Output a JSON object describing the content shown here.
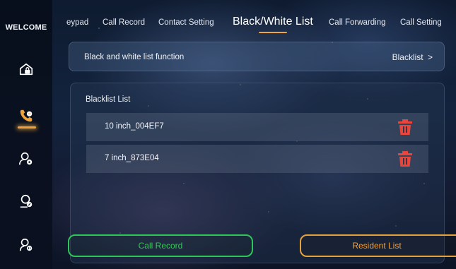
{
  "sidebar": {
    "title": "WELCOME",
    "items": [
      {
        "icon": "home-lock-icon"
      },
      {
        "icon": "phone-icon",
        "active": true
      },
      {
        "icon": "user-settings-icon"
      },
      {
        "icon": "user-edit-icon"
      },
      {
        "icon": "user-info-icon"
      }
    ]
  },
  "tabs": [
    {
      "label": "eypad"
    },
    {
      "label": "Call Record"
    },
    {
      "label": "Contact Setting"
    },
    {
      "label": "Black/White List",
      "active": true
    },
    {
      "label": "Call Forwarding"
    },
    {
      "label": "Call Setting"
    }
  ],
  "function_bar": {
    "label": "Black and white list function",
    "value": "Blacklist",
    "chevron": ">"
  },
  "blacklist": {
    "title": "Blacklist List",
    "items": [
      {
        "name": "10 inch_004EF7"
      },
      {
        "name": "7 inch_873E04"
      }
    ]
  },
  "buttons": {
    "call_record": "Call Record",
    "resident_list": "Resident List"
  },
  "colors": {
    "accent": "#f2a53c",
    "delete": "#e8463c",
    "green": "#2fc659"
  }
}
